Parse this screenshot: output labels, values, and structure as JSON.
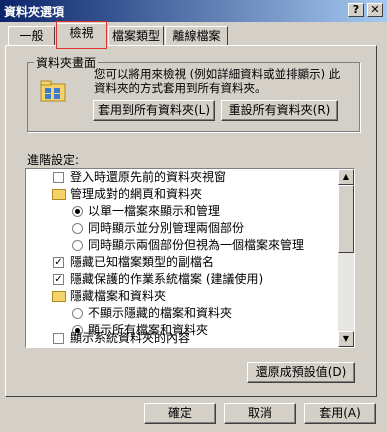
{
  "window": {
    "title": "資料夾選項",
    "help_label": "?",
    "close_label": "✕"
  },
  "tabs": [
    {
      "label": "一般"
    },
    {
      "label": "檢視"
    },
    {
      "label": "檔案類型"
    },
    {
      "label": "離線檔案"
    }
  ],
  "folder_views": {
    "group_label": "資料夾畫面",
    "description_line1": "您可以將用來檢視 (例如詳細資料或並排顯示) 此",
    "description_line2": "資料夾的方式套用到所有資料夾。",
    "apply_all_label": "套用到所有資料夾(L)",
    "reset_all_label": "重設所有資料夾(R)"
  },
  "advanced": {
    "label": "進階設定:",
    "items": [
      {
        "kind": "checkbox",
        "checked": false,
        "level": 1,
        "label": "登入時還原先前的資料夾視窗"
      },
      {
        "kind": "folder",
        "level": 1,
        "label": "管理成對的網頁和資料夾"
      },
      {
        "kind": "radio",
        "checked": true,
        "level": 2,
        "label": "以單一檔案來顯示和管理"
      },
      {
        "kind": "radio",
        "checked": false,
        "level": 2,
        "label": "同時顯示並分別管理兩個部份"
      },
      {
        "kind": "radio",
        "checked": false,
        "level": 2,
        "label": "同時顯示兩個部份但視為一個檔案來管理"
      },
      {
        "kind": "checkbox",
        "checked": true,
        "level": 1,
        "label": "隱藏已知檔案類型的副檔名"
      },
      {
        "kind": "checkbox",
        "checked": true,
        "level": 1,
        "label": "隱藏保護的作業系統檔案 (建議使用)"
      },
      {
        "kind": "folder",
        "level": 1,
        "label": "隱藏檔案和資料夾"
      },
      {
        "kind": "radio",
        "checked": false,
        "level": 2,
        "label": "不顯示隱藏的檔案和資料夾"
      },
      {
        "kind": "radio",
        "checked": true,
        "level": 2,
        "label": "顯示所有檔案和資料夾"
      },
      {
        "kind": "checkbox",
        "checked": false,
        "level": 1,
        "label": "顯示系統資料夾的內容"
      }
    ],
    "restore_defaults_label": "還原成預設值(D)"
  },
  "buttons": {
    "ok": "確定",
    "cancel": "取消",
    "apply": "套用(A)"
  },
  "scrollbar": {
    "up_icon": "arrow-up-icon",
    "down_icon": "arrow-down-icon"
  },
  "icons": {
    "folder_views": "folder-views-icon",
    "folder": "folder-icon"
  },
  "colors": {
    "titlebar_start": "#0a246a",
    "titlebar_end": "#a6caf0",
    "face": "#d4d0c8",
    "highlight": "#e03030"
  }
}
